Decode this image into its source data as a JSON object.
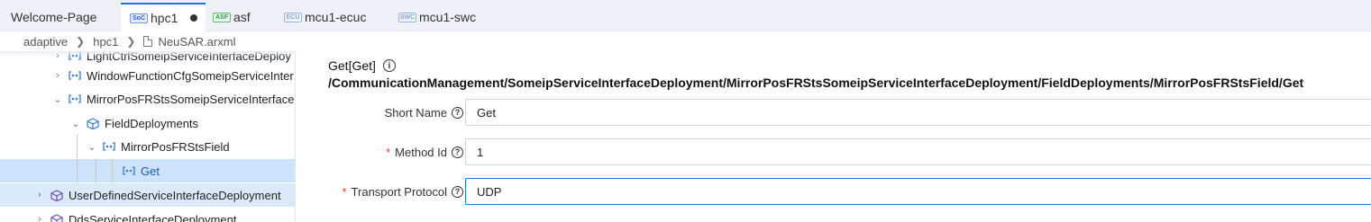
{
  "tabs": [
    {
      "label": "Welcome-Page",
      "badge": ""
    },
    {
      "label": "hpc1",
      "badge": "SoC"
    },
    {
      "label": "asf",
      "badge": "ASF"
    },
    {
      "label": "mcu1-ecuc",
      "badge": "ECU"
    },
    {
      "label": "mcu1-swc",
      "badge": "SWC"
    }
  ],
  "breadcrumb": [
    "adaptive",
    "hpc1",
    "NeuSAR.arxml"
  ],
  "tree": [
    {
      "label": "LightCtrlSomeipServiceInterfaceDeploy",
      "icon": "deployment-icon"
    },
    {
      "label": "WindowFunctionCfgSomeipServiceInter",
      "icon": "deployment-icon"
    },
    {
      "label": "MirrorPosFRStsSomeipServiceInterface",
      "icon": "deployment-icon"
    },
    {
      "label": "FieldDeployments",
      "icon": "package-icon"
    },
    {
      "label": "MirrorPosFRStsField",
      "icon": "deployment-icon"
    },
    {
      "label": "Get",
      "icon": "deployment-icon"
    },
    {
      "label": "UserDefinedServiceInterfaceDeployment",
      "icon": "package-icon"
    },
    {
      "label": "DdsServiceInterfaceDeployment",
      "icon": "package-icon"
    }
  ],
  "detail": {
    "title": "Get[Get]",
    "path": "/CommunicationManagement/SomeipServiceInterfaceDeployment/MirrorPosFRStsSomeipServiceInterfaceDeployment/FieldDeployments/MirrorPosFRStsField/Get",
    "fields": [
      {
        "label": "Short Name",
        "required": false,
        "value": "Get"
      },
      {
        "label": "Method Id",
        "required": true,
        "value": "1"
      },
      {
        "label": "Transport Protocol",
        "required": true,
        "value": "UDP"
      }
    ],
    "required_mark": "*"
  },
  "colors": {
    "accent": "#1a73e8",
    "selected_row": "#cde3fb",
    "required": "#e53935",
    "tab_bar": "#eef2f8"
  }
}
